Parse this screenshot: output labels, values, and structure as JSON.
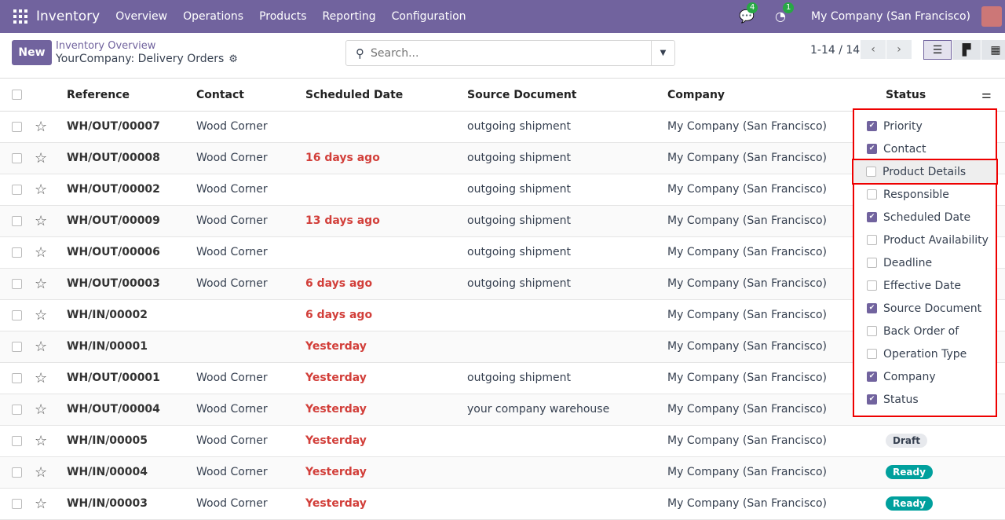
{
  "nav": {
    "app": "Inventory",
    "menus": [
      "Overview",
      "Operations",
      "Products",
      "Reporting",
      "Configuration"
    ],
    "messages_badge": "4",
    "activity_badge": "1",
    "company": "My Company (San Francisco)"
  },
  "control": {
    "new_label": "New",
    "breadcrumb_parent": "Inventory Overview",
    "breadcrumb_current": "YourCompany: Delivery Orders",
    "search_placeholder": "Search...",
    "pager": "1-14 / 14"
  },
  "columns": [
    "Reference",
    "Contact",
    "Scheduled Date",
    "Source Document",
    "Company",
    "Status"
  ],
  "rows": [
    [
      "WH/OUT/00007",
      "Wood Corner",
      "",
      "outgoing shipment",
      "My Company (San Francisco)",
      ""
    ],
    [
      "WH/OUT/00008",
      "Wood Corner",
      "16 days ago",
      "outgoing shipment",
      "My Company (San Francisco)",
      ""
    ],
    [
      "WH/OUT/00002",
      "Wood Corner",
      "",
      "outgoing shipment",
      "My Company (San Francisco)",
      ""
    ],
    [
      "WH/OUT/00009",
      "Wood Corner",
      "13 days ago",
      "outgoing shipment",
      "My Company (San Francisco)",
      ""
    ],
    [
      "WH/OUT/00006",
      "Wood Corner",
      "",
      "outgoing shipment",
      "My Company (San Francisco)",
      ""
    ],
    [
      "WH/OUT/00003",
      "Wood Corner",
      "6 days ago",
      "outgoing shipment",
      "My Company (San Francisco)",
      ""
    ],
    [
      "WH/IN/00002",
      "",
      "6 days ago",
      "",
      "My Company (San Francisco)",
      ""
    ],
    [
      "WH/IN/00001",
      "",
      "Yesterday",
      "",
      "My Company (San Francisco)",
      ""
    ],
    [
      "WH/OUT/00001",
      "Wood Corner",
      "Yesterday",
      "outgoing shipment",
      "My Company (San Francisco)",
      ""
    ],
    [
      "WH/OUT/00004",
      "Wood Corner",
      "Yesterday",
      "your company warehouse",
      "My Company (San Francisco)",
      ""
    ],
    [
      "WH/IN/00005",
      "Wood Corner",
      "Yesterday",
      "",
      "My Company (San Francisco)",
      "Draft"
    ],
    [
      "WH/IN/00004",
      "Wood Corner",
      "Yesterday",
      "",
      "My Company (San Francisco)",
      "Ready"
    ],
    [
      "WH/IN/00003",
      "Wood Corner",
      "Yesterday",
      "",
      "My Company (San Francisco)",
      "Ready"
    ]
  ],
  "optional_columns": [
    {
      "label": "Priority",
      "checked": true
    },
    {
      "label": "Contact",
      "checked": true
    },
    {
      "label": "Product Details",
      "checked": false,
      "highlighted": true
    },
    {
      "label": "Responsible",
      "checked": false
    },
    {
      "label": "Scheduled Date",
      "checked": true
    },
    {
      "label": "Product Availability",
      "checked": false
    },
    {
      "label": "Deadline",
      "checked": false
    },
    {
      "label": "Effective Date",
      "checked": false
    },
    {
      "label": "Source Document",
      "checked": true
    },
    {
      "label": "Back Order of",
      "checked": false
    },
    {
      "label": "Operation Type",
      "checked": false
    },
    {
      "label": "Company",
      "checked": true
    },
    {
      "label": "Status",
      "checked": true
    }
  ],
  "colors": {
    "brand": "#71639e",
    "late": "#d23f3a",
    "ready": "#00a09d",
    "highlight_border": "#ee0000"
  }
}
